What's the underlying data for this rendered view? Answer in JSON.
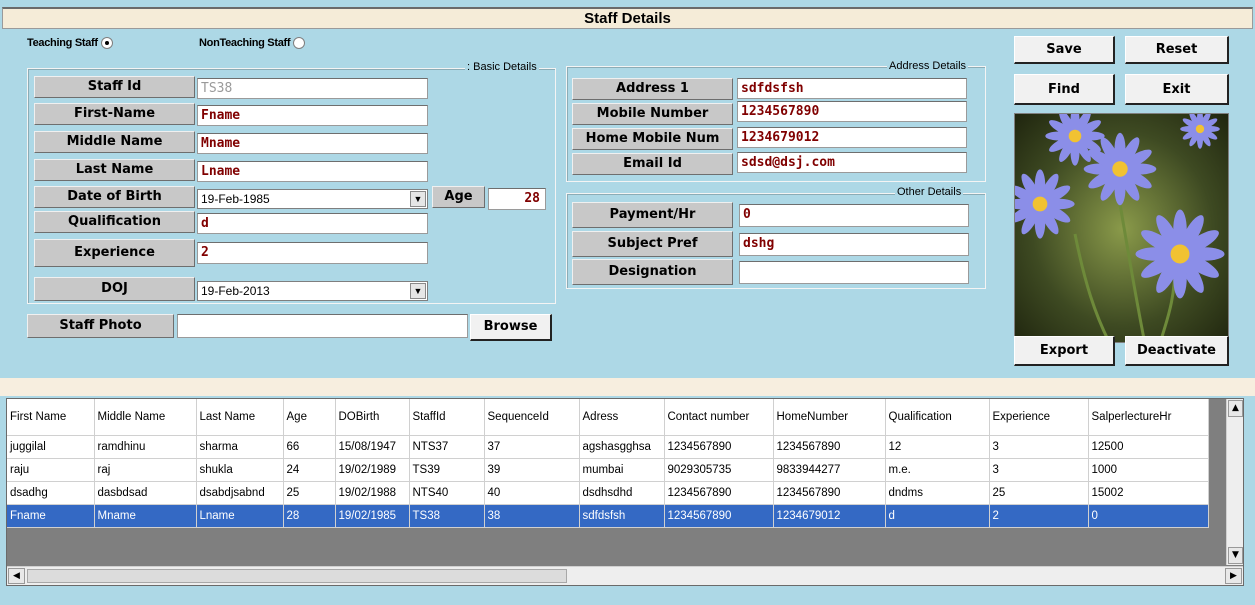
{
  "window": {
    "title": "Staff Details"
  },
  "staff_type": {
    "teaching_label": "Teaching Staff",
    "teaching_selected": true,
    "nonteaching_label": "NonTeaching Staff",
    "nonteaching_selected": false
  },
  "basic": {
    "legend": ": Basic  Details",
    "staff_id_label": "Staff Id",
    "staff_id": "TS38",
    "first_name_label": "First-Name",
    "first_name": "Fname",
    "middle_name_label": "Middle Name",
    "middle_name": "Mname",
    "last_name_label": "Last Name",
    "last_name": "Lname",
    "dob_label": "Date of Birth",
    "dob": "19-Feb-1985",
    "age_label": "Age",
    "age": "28",
    "qualification_label": "Qualification",
    "qualification": "d",
    "experience_label": "Experience",
    "experience": "2",
    "doj_label": "DOJ",
    "doj": "19-Feb-2013"
  },
  "photo": {
    "label": "Staff Photo",
    "path": "",
    "browse": "Browse"
  },
  "address": {
    "legend": "Address Details",
    "address1_label": "Address 1",
    "address1": "sdfdsfsh",
    "mobile_label": "Mobile Number",
    "mobile": "1234567890",
    "home_mobile_label": "Home Mobile Num",
    "home_mobile": "1234679012",
    "email_label": "Email Id",
    "email": "sdsd@dsj.com"
  },
  "other": {
    "legend": "Other Details",
    "payment_label": "Payment/Hr",
    "payment": "0",
    "subject_label": "Subject Pref",
    "subject": "dshg",
    "designation_label": "Designation",
    "designation": ""
  },
  "buttons": {
    "save": "Save",
    "reset": "Reset",
    "find": "Find",
    "exit": "Exit",
    "export": "Export",
    "deactivate": "Deactivate"
  },
  "grid": {
    "columns": [
      "First Name",
      "Middle Name",
      "Last Name",
      "Age",
      "DOBirth",
      "StaffId",
      "SequenceId",
      "Adress",
      "Contact number",
      "HomeNumber",
      "Qualification",
      "Experience",
      "SalperlectureHr"
    ],
    "rows": [
      [
        "juggilal",
        "ramdhinu",
        "sharma",
        "66",
        "15/08/1947",
        "NTS37",
        "37",
        "agshasgghsa",
        "1234567890",
        "1234567890",
        "12",
        "3",
        "12500"
      ],
      [
        "raju",
        "raj",
        "shukla",
        "24",
        "19/02/1989",
        "TS39",
        "39",
        "mumbai",
        "9029305735",
        "9833944277",
        "m.e.",
        "3",
        "1000"
      ],
      [
        "dsadhg",
        "dasbdsad",
        "dsabdjsabnd",
        "25",
        "19/02/1988",
        "NTS40",
        "40",
        "dsdhsdhd",
        "1234567890",
        "1234567890",
        "dndms",
        "25",
        "15002"
      ],
      [
        "Fname",
        "Mname",
        "Lname",
        "28",
        "19/02/1985",
        "TS38",
        "38",
        "sdfdsfsh",
        "1234567890",
        "1234679012",
        "d",
        "2",
        "0"
      ]
    ],
    "selected_row": 3
  }
}
